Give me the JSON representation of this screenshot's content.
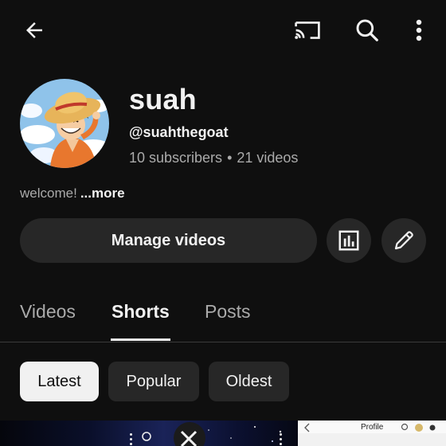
{
  "header": {
    "back_icon": "arrow-left-icon",
    "cast_icon": "cast-icon",
    "search_icon": "search-icon",
    "more_icon": "more-vert-icon"
  },
  "channel": {
    "name": "suah",
    "handle": "@suahthegoat",
    "subscribers": "10 subscribers",
    "separator": "•",
    "videos": "21 videos",
    "description": "welcome!",
    "more_label": "...more"
  },
  "actions": {
    "manage_label": "Manage videos",
    "analytics_icon": "analytics-icon",
    "edit_icon": "pencil-icon"
  },
  "tabs": [
    {
      "label": "Videos",
      "active": false
    },
    {
      "label": "Shorts",
      "active": true
    },
    {
      "label": "Posts",
      "active": false
    }
  ],
  "filters": [
    {
      "label": "Latest",
      "active": true
    },
    {
      "label": "Popular",
      "active": false
    },
    {
      "label": "Oldest",
      "active": false
    }
  ],
  "shorts_preview": {
    "third_thumbnail_label": "Profile"
  },
  "colors": {
    "background": "#0f0f0f",
    "surface": "#272727",
    "text_primary": "#f1f1f1",
    "text_secondary": "#aaaaaa"
  }
}
